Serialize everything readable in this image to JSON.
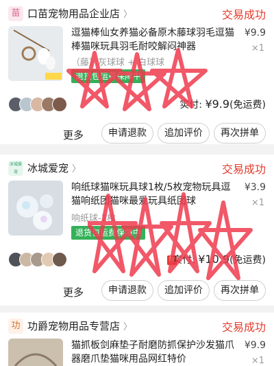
{
  "colors": {
    "accent_red": "#e53b2d",
    "badge_green": "#35b15a",
    "scribble": "#ef3b4e"
  },
  "orders": [
    {
      "shop_name": "口苗宠物用品企业店",
      "shop_logo_text": "苗",
      "status": "交易成功",
      "title": "逗猫棒仙女养猫必备原木藤球羽毛逗猫棒猫咪玩具羽毛耐咬解闷神器",
      "price": "¥9.9",
      "qty": "×1",
      "sku": "（藤）灰球球 + 白球球",
      "badge": "退货包运费保障中",
      "paid_label": "实付:",
      "paid_amount": "¥9.9",
      "shipping": "(免运费)",
      "more": "更多",
      "buttons": [
        "申请退款",
        "追加评价",
        "再次拼单"
      ]
    },
    {
      "shop_name": "冰城爱宠",
      "shop_logo_text": "冰城爱宠",
      "status": "交易成功",
      "title": "响纸球猫咪玩具球1枚/5枚宠物玩具逗猫响纸团猫咪最爱玩具纸团球",
      "price": "¥3.9",
      "qty": "×1",
      "sku": "响纸球-1枚",
      "badge": "退货包运费保障中",
      "pay_badge": "拼",
      "paid_label": "实付:",
      "paid_amount": "¥10.9",
      "shipping": "(免运费)",
      "more": "更多",
      "buttons": [
        "申请退款",
        "追加评价",
        "再次拼单"
      ]
    },
    {
      "shop_name": "功爵宠物用品专营店",
      "shop_logo_text": "功",
      "status": "交易成功",
      "title": "猫抓板剑麻垫子耐磨防抓保护沙发猫爪器磨爪垫猫咪用品网红特价",
      "price": "¥9.9",
      "qty": "×1"
    }
  ]
}
